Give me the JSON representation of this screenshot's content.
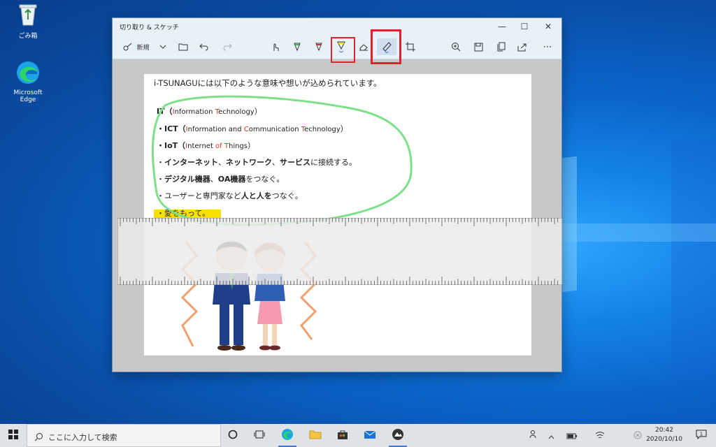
{
  "desktop": {
    "icons": [
      {
        "label": "ごみ箱",
        "icon": "recycle-bin-icon"
      },
      {
        "label": "Microsoft Edge",
        "icon": "edge-icon"
      }
    ]
  },
  "window": {
    "title": "切り取り & スケッチ",
    "controls": [
      "minimize",
      "maximize",
      "close"
    ],
    "toolbar": {
      "new_label": "新規",
      "more_label": "⋯"
    }
  },
  "content": {
    "heading": "i-TSUNAGUには以下のような意味や想いが込められています。",
    "items": [
      {
        "abbr": "IT",
        "open": "（",
        "parts": [
          [
            "I",
            "r"
          ],
          [
            "nformation ",
            ""
          ],
          [
            "T",
            "r"
          ],
          [
            "echnology",
            ""
          ]
        ],
        "close": "）"
      },
      {
        "abbr": "・ICT",
        "open": "（",
        "parts": [
          [
            "I",
            "r"
          ],
          [
            "nformation and ",
            ""
          ],
          [
            "C",
            "r"
          ],
          [
            "ommunication ",
            ""
          ],
          [
            "T",
            "r"
          ],
          [
            "echnology",
            ""
          ]
        ],
        "close": "）"
      },
      {
        "abbr": "・IoT",
        "open": "（",
        "parts": [
          [
            "I",
            "r"
          ],
          [
            "nternet ",
            ""
          ],
          [
            "of",
            "r"
          ],
          [
            " ",
            ""
          ],
          [
            "T",
            "r"
          ],
          [
            "hings",
            ""
          ]
        ],
        "close": "）"
      }
    ],
    "line4": {
      "prefix": "・",
      "b1": "インターネット",
      "s1": "、",
      "b2": "ネットワーク",
      "s2": "、",
      "b3": "サービス",
      "tail": "に接続する。"
    },
    "line5": {
      "prefix": "・",
      "b1": "デジタル機器",
      "s1": "、",
      "b2": "OA機器",
      "tail": "をつなぐ。"
    },
    "line6": {
      "prefix": "・ユーザーと専門家など",
      "b1": "人と人を",
      "tail": "つなぐ。"
    },
    "line7": {
      "text": "・愛をもって。"
    }
  },
  "taskbar": {
    "search_placeholder": "ここに入力して検索",
    "time": "20:42",
    "date": "2020/10/10"
  },
  "colors": {
    "highlight_box": "#e0202a",
    "green_ink": "#7ee08a",
    "yellow_highlight": "#f6e100",
    "accent": "#3a7bd5"
  }
}
